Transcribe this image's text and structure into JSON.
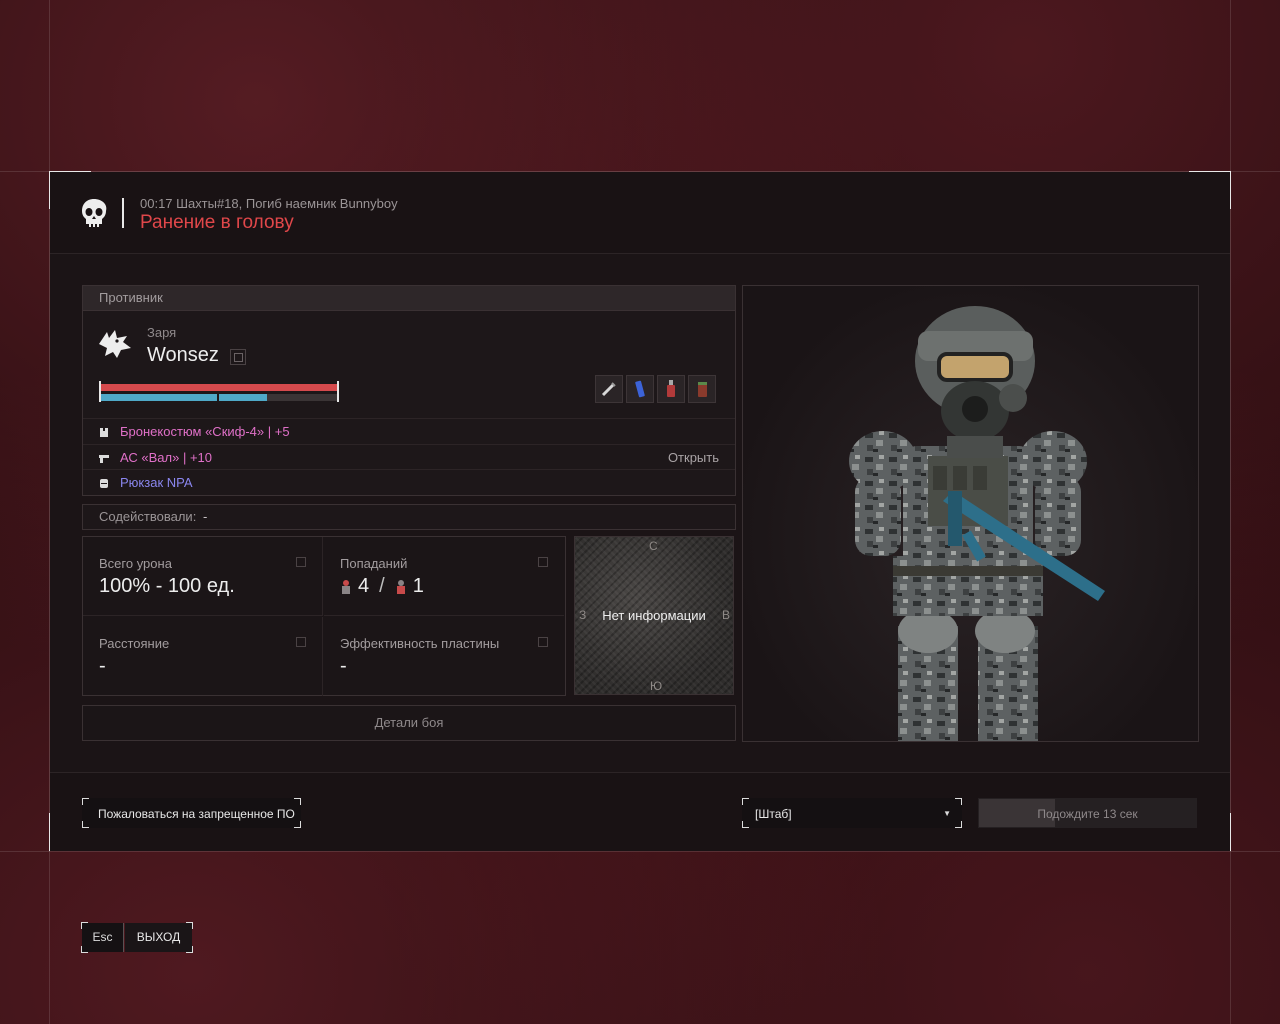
{
  "header": {
    "subtitle": "00:17 Шахты#18, Погиб наемник Bunnyboy",
    "title": "Ранение в голову"
  },
  "enemy": {
    "section_label": "Противник",
    "faction": "Заря",
    "name": "Wonsez",
    "health_fraction": 1.0,
    "armor_fraction": 0.7,
    "equipment": [
      {
        "icon": "armor-icon",
        "name": "Бронекостюм «Скиф-4»",
        "suffix": " | +5",
        "color": "#e070c8"
      },
      {
        "icon": "gun-icon",
        "name": "АС «Вал»",
        "suffix": " | +10",
        "color": "#e070c8"
      },
      {
        "icon": "backpack-icon",
        "name": "Рюкзак NPA",
        "suffix": "",
        "color": "#8a86ee"
      }
    ],
    "open_label": "Открыть",
    "quick_items": [
      "syringe-icon",
      "energy-drink-icon",
      "bottle-icon",
      "can-icon"
    ]
  },
  "assist": {
    "label": "Содействовали:",
    "value": "-"
  },
  "stats": {
    "total_damage": {
      "label": "Всего урона",
      "value": "100% - 100 ед."
    },
    "hits": {
      "label": "Попаданий",
      "first": "4",
      "second": "1"
    },
    "distance": {
      "label": "Расстояние",
      "value": "-"
    },
    "plate_efficiency": {
      "label": "Эффективность пластины",
      "value": "-"
    }
  },
  "map": {
    "north": "С",
    "west": "З",
    "east": "В",
    "south": "Ю",
    "no_info": "Нет информации"
  },
  "details_button": "Детали боя",
  "footer": {
    "report_button": "Пожаловаться на запрещенное ПО",
    "select_value": "[Штаб]",
    "wait_button": "Подождите 13 сек",
    "wait_progress": 0.35
  },
  "exit": {
    "key": "Esc",
    "label": "ВЫХОД"
  },
  "colors": {
    "accent_red": "#e0474a",
    "health": "#d54a4d",
    "armor": "#4fa9c8"
  }
}
